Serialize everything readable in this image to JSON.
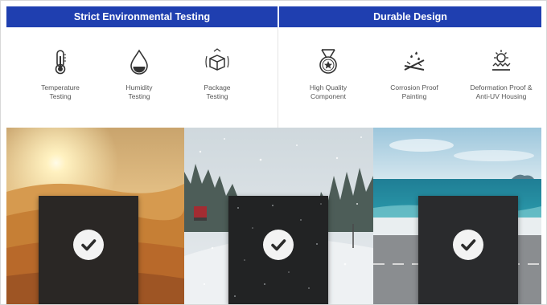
{
  "headers": {
    "environmental": "Strict Environmental Testing",
    "durable": "Durable Design"
  },
  "features": [
    {
      "icon": "thermometer-icon",
      "line1": "Temperature",
      "line2": "Testing"
    },
    {
      "icon": "water-drop-icon",
      "line1": "Humidity",
      "line2": "Testing"
    },
    {
      "icon": "package-icon",
      "line1": "Package",
      "line2": "Testing"
    },
    {
      "icon": "award-badge-icon",
      "line1": "High Quality",
      "line2": "Component"
    },
    {
      "icon": "corrosion-icon",
      "line1": "Corrosion Proof",
      "line2": "Painting"
    },
    {
      "icon": "sun-shield-icon",
      "line1": "Deformation Proof &",
      "line2": "Anti-UV Housing"
    }
  ],
  "panels": [
    {
      "scene": "desert",
      "badge": "checkmark-icon"
    },
    {
      "scene": "snow",
      "badge": "checkmark-icon"
    },
    {
      "scene": "seaside",
      "badge": "checkmark-icon"
    }
  ],
  "colors": {
    "header_bg": "#1f3fb0",
    "header_text": "#ffffff",
    "label_text": "#555555"
  }
}
